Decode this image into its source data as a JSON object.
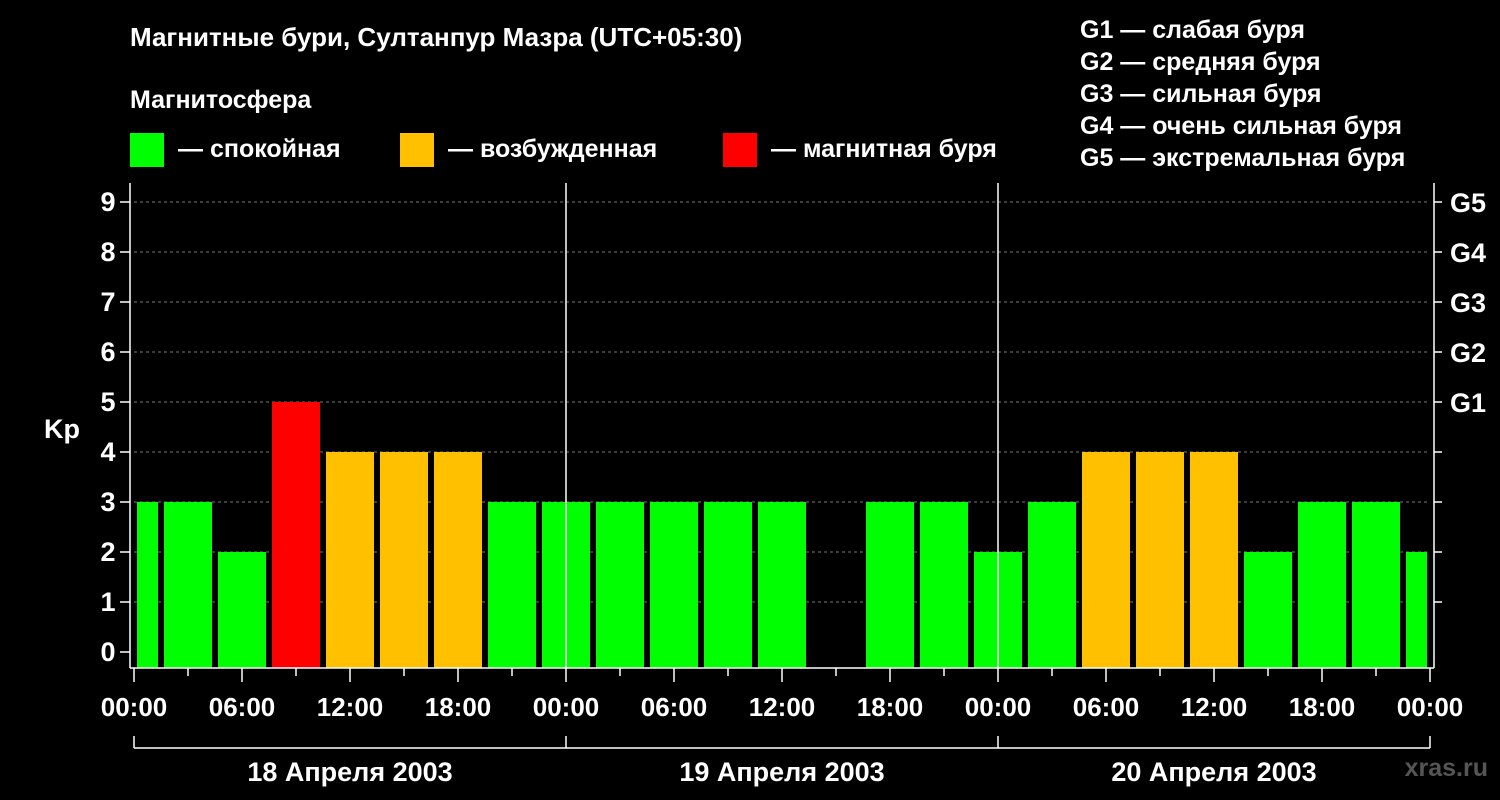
{
  "title": "Магнитные бури, Султанпур Мазра (UTC+05:30)",
  "subtitle": "Магнитосфера",
  "legend": [
    {
      "label": "— спокойная",
      "color": "#00ff00"
    },
    {
      "label": "— возбужденная",
      "color": "#ffc000"
    },
    {
      "label": "— магнитная буря",
      "color": "#ff0000"
    }
  ],
  "g_scale": [
    "G1 — слабая буря",
    "G2 — средняя буря",
    "G3 — сильная буря",
    "G4 — очень сильная буря",
    "G5 — экстремальная буря"
  ],
  "watermark": "xras.ru",
  "chart_data": {
    "type": "bar",
    "ylabel": "Kp",
    "ylim": [
      0,
      9
    ],
    "yticks": [
      0,
      1,
      2,
      3,
      4,
      5,
      6,
      7,
      8,
      9
    ],
    "right_ticks": [
      "G1",
      "G2",
      "G3",
      "G4",
      "G5"
    ],
    "x_tick_labels": [
      "00:00",
      "06:00",
      "12:00",
      "18:00",
      "00:00",
      "06:00",
      "12:00",
      "18:00",
      "00:00",
      "06:00",
      "12:00",
      "18:00",
      "00:00"
    ],
    "days": [
      "18 Апреля 2003",
      "19 Апреля 2003",
      "20 Апреля 2003"
    ],
    "bars": [
      {
        "start": "2003-04-18T00:00",
        "end": "2003-04-18T01:30",
        "kp": 3
      },
      {
        "start": "2003-04-18T01:30",
        "end": "2003-04-18T04:30",
        "kp": 3
      },
      {
        "start": "2003-04-18T04:30",
        "end": "2003-04-18T07:30",
        "kp": 2
      },
      {
        "start": "2003-04-18T07:30",
        "end": "2003-04-18T10:30",
        "kp": 5
      },
      {
        "start": "2003-04-18T10:30",
        "end": "2003-04-18T13:30",
        "kp": 4
      },
      {
        "start": "2003-04-18T13:30",
        "end": "2003-04-18T16:30",
        "kp": 4
      },
      {
        "start": "2003-04-18T16:30",
        "end": "2003-04-18T19:30",
        "kp": 4
      },
      {
        "start": "2003-04-18T19:30",
        "end": "2003-04-18T22:30",
        "kp": 3
      },
      {
        "start": "2003-04-18T22:30",
        "end": "2003-04-19T01:30",
        "kp": 3
      },
      {
        "start": "2003-04-19T01:30",
        "end": "2003-04-19T04:30",
        "kp": 3
      },
      {
        "start": "2003-04-19T04:30",
        "end": "2003-04-19T07:30",
        "kp": 3
      },
      {
        "start": "2003-04-19T07:30",
        "end": "2003-04-19T10:30",
        "kp": 3
      },
      {
        "start": "2003-04-19T10:30",
        "end": "2003-04-19T13:30",
        "kp": 3
      },
      {
        "start": "2003-04-19T13:30",
        "end": "2003-04-19T16:30",
        "kp": 0
      },
      {
        "start": "2003-04-19T16:30",
        "end": "2003-04-19T19:30",
        "kp": 3
      },
      {
        "start": "2003-04-19T19:30",
        "end": "2003-04-19T22:30",
        "kp": 3
      },
      {
        "start": "2003-04-19T22:30",
        "end": "2003-04-20T01:30",
        "kp": 2
      },
      {
        "start": "2003-04-20T01:30",
        "end": "2003-04-20T04:30",
        "kp": 3
      },
      {
        "start": "2003-04-20T04:30",
        "end": "2003-04-20T07:30",
        "kp": 4
      },
      {
        "start": "2003-04-20T07:30",
        "end": "2003-04-20T10:30",
        "kp": 4
      },
      {
        "start": "2003-04-20T10:30",
        "end": "2003-04-20T13:30",
        "kp": 4
      },
      {
        "start": "2003-04-20T13:30",
        "end": "2003-04-20T16:30",
        "kp": 2
      },
      {
        "start": "2003-04-20T16:30",
        "end": "2003-04-20T19:30",
        "kp": 3
      },
      {
        "start": "2003-04-20T19:30",
        "end": "2003-04-20T22:30",
        "kp": 3
      },
      {
        "start": "2003-04-20T22:30",
        "end": "2003-04-21T00:00",
        "kp": 2
      }
    ]
  }
}
